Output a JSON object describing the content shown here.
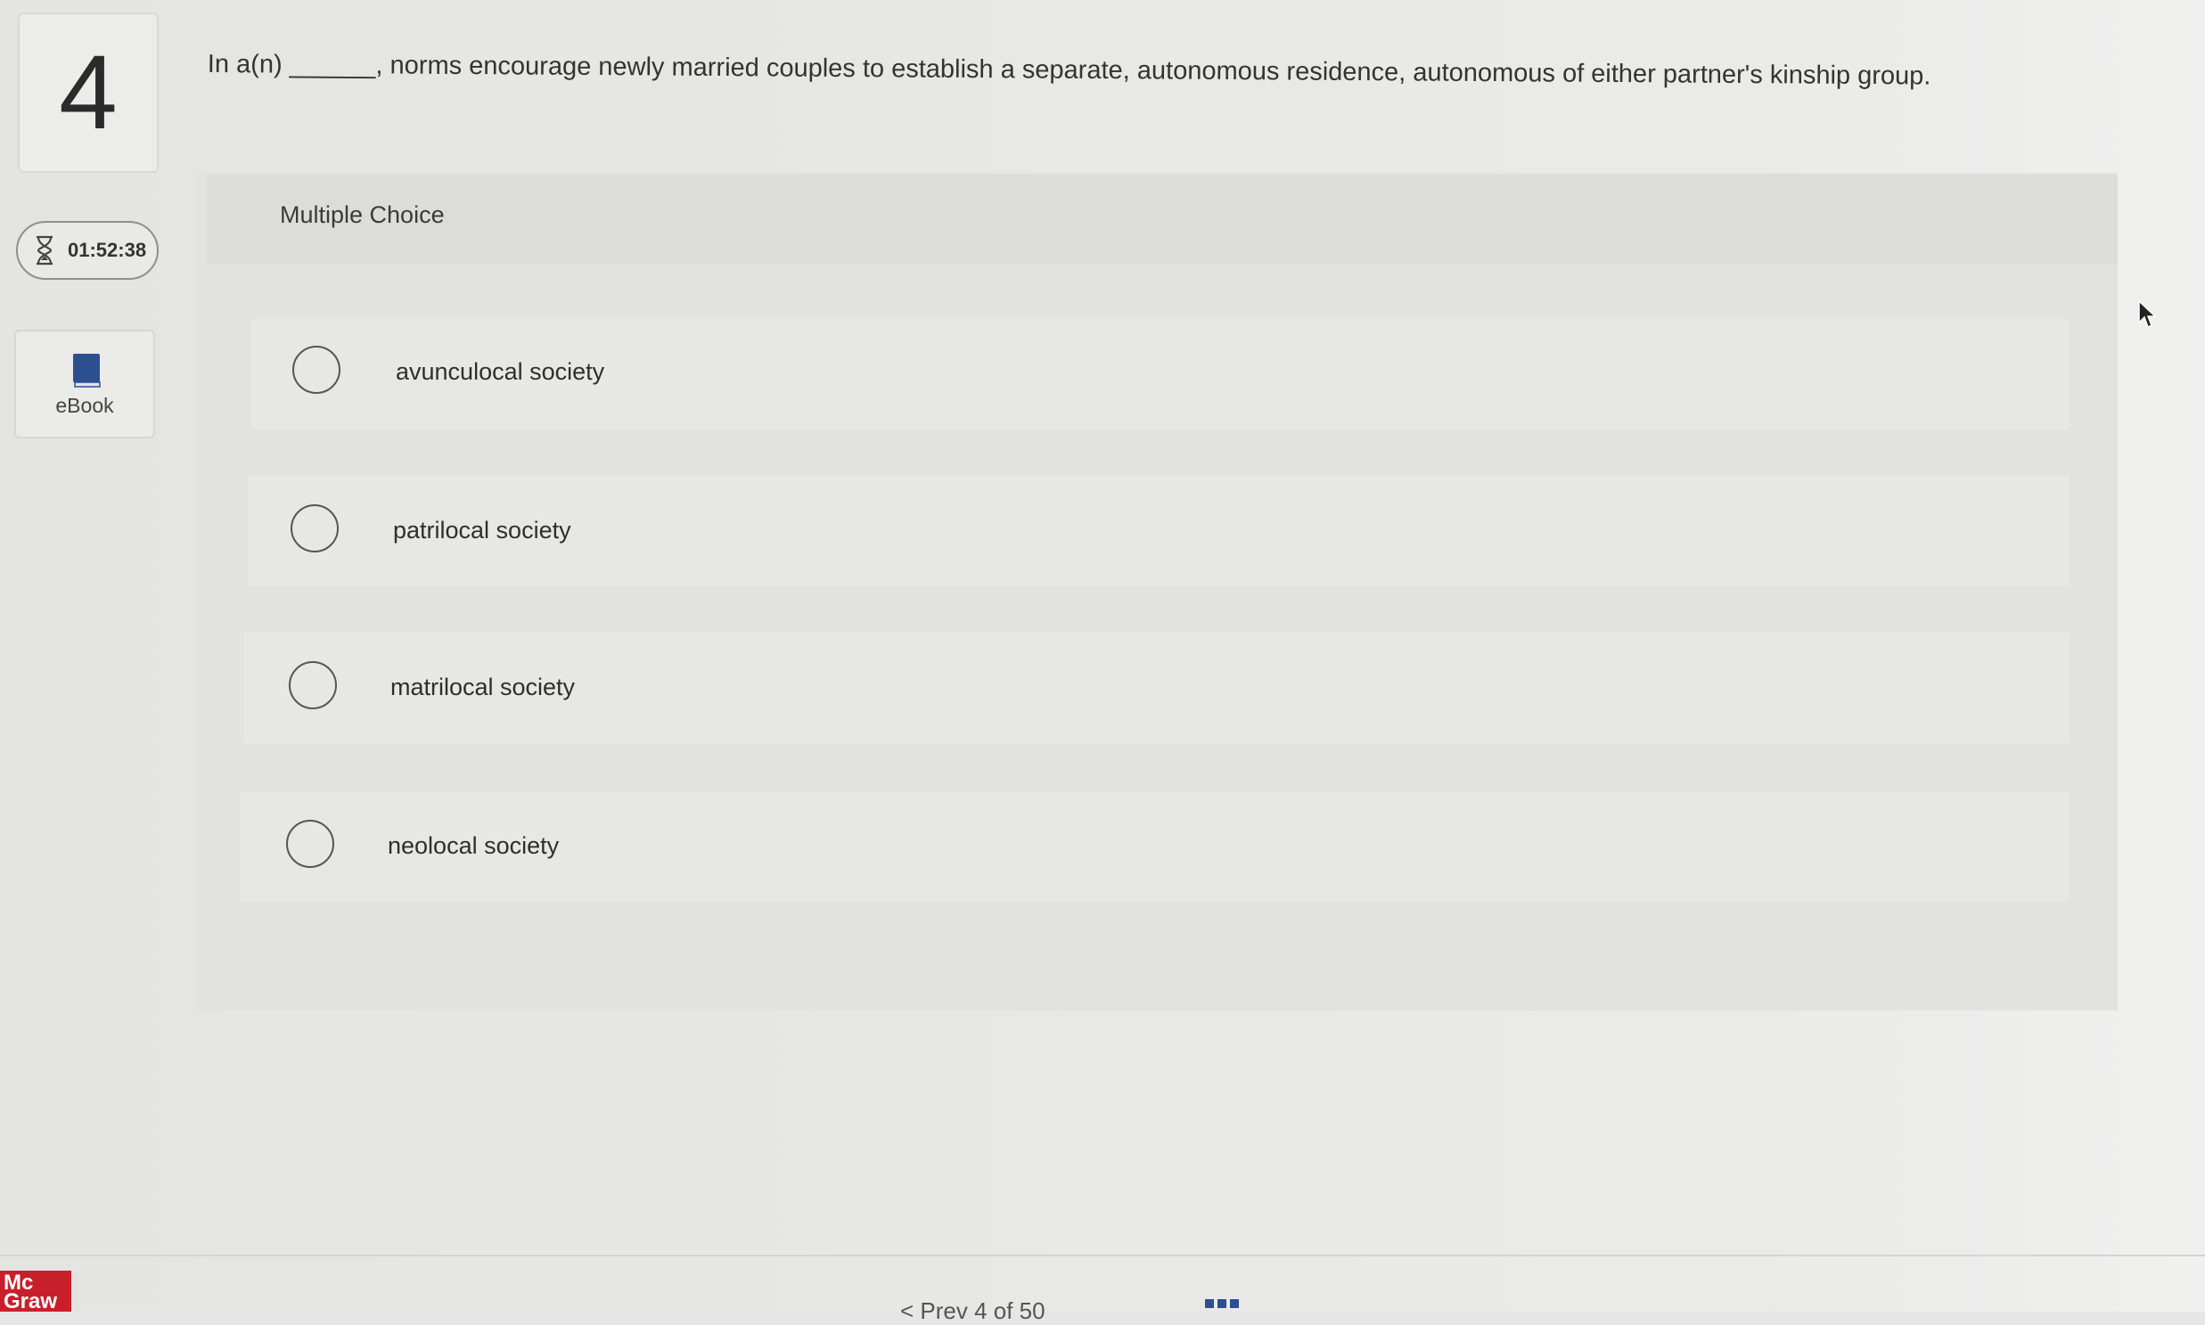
{
  "question": {
    "number": "4",
    "text": "In a(n) ______, norms encourage newly married couples to establish a separate, autonomous residence, autonomous of either partner's kinship group."
  },
  "timer": {
    "icon": "hourglass-icon",
    "value": "01:52:38"
  },
  "ebook": {
    "icon": "book-icon",
    "label": "eBook"
  },
  "panel": {
    "title": "Multiple Choice"
  },
  "options": [
    {
      "label": "avunculocal society",
      "selected": false
    },
    {
      "label": "patrilocal society",
      "selected": false
    },
    {
      "label": "matrilocal society",
      "selected": false
    },
    {
      "label": "neolocal society",
      "selected": false
    }
  ],
  "footer": {
    "logo_line1": "Mc",
    "logo_line2": "Graw",
    "nav_partial": "< Prev    4  of 50",
    "grid_icon": "grid-icon"
  },
  "colors": {
    "logo_red": "#c8202a",
    "ebook_blue": "#2c4f8f"
  }
}
